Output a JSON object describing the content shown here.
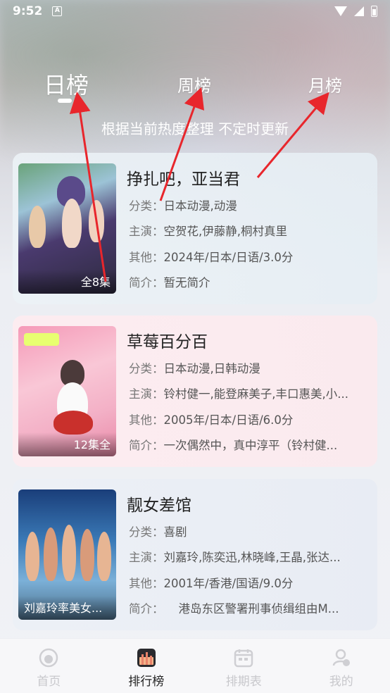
{
  "status_bar": {
    "time": "9:52",
    "notif_letter": "A"
  },
  "tabs": [
    {
      "label": "日榜",
      "active": true
    },
    {
      "label": "周榜",
      "active": false
    },
    {
      "label": "月榜",
      "active": false
    }
  ],
  "subtitle": "根据当前热度整理 不定时更新",
  "items": [
    {
      "title": "挣扎吧，亚当君",
      "category_label": "分类：",
      "category": "日本动漫,动漫",
      "cast_label": "主演：",
      "cast": "空贺花,伊藤静,桐村真里",
      "other_label": "其他：",
      "other": "2024年/日本/日语/3.0分",
      "intro_label": "简介：",
      "intro": "暂无简介",
      "episodes": "全8集"
    },
    {
      "title": "草莓百分百",
      "category_label": "分类：",
      "category": "日本动漫,日韩动漫",
      "cast_label": "主演：",
      "cast": "铃村健一,能登麻美子,丰口惠美,小...",
      "other_label": "其他：",
      "other": "2005年/日本/日语/6.0分",
      "intro_label": "简介：",
      "intro": "一次偶然中，真中淳平（铃村健...",
      "episodes": "12集全"
    },
    {
      "title": "靓女差馆",
      "category_label": "分类：",
      "category": "喜剧",
      "cast_label": "主演：",
      "cast": "刘嘉玲,陈奕迅,林晓峰,王晶,张达...",
      "other_label": "其他：",
      "other": "2001年/香港/国语/9.0分",
      "intro_label": "简介：",
      "intro": "港岛东区警署刑事侦缉组由M...",
      "episodes": "刘嘉玲率美女..."
    }
  ],
  "bottom_nav": [
    {
      "label": "首页",
      "icon": "home-icon",
      "active": false
    },
    {
      "label": "排行榜",
      "icon": "ranking-icon",
      "active": true
    },
    {
      "label": "排期表",
      "icon": "calendar-icon",
      "active": false
    },
    {
      "label": "我的",
      "icon": "profile-icon",
      "active": false
    }
  ],
  "colors": {
    "accent_arrow": "#e8262c",
    "active_text": "#222222",
    "inactive_nav": "#c8c8cc"
  }
}
